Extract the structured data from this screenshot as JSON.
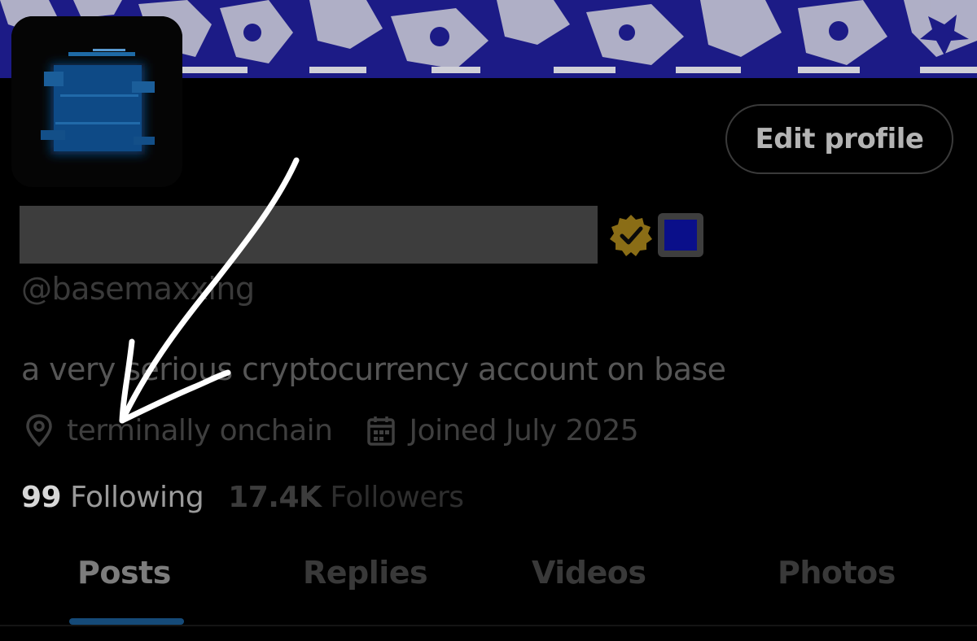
{
  "profile": {
    "handle": "@basemaxxing",
    "bio": "a very serious cryptocurrency account on base",
    "location": "terminally onchain",
    "joined": "Joined July 2025",
    "edit_profile_label": "Edit profile"
  },
  "stats": {
    "following_count": "99",
    "following_label": "Following",
    "followers_count": "17.4K",
    "followers_label": "Followers"
  },
  "tabs": [
    {
      "label": "Posts",
      "active": true
    },
    {
      "label": "Replies",
      "active": false
    },
    {
      "label": "Videos",
      "active": false
    },
    {
      "label": "Photos",
      "active": false
    }
  ],
  "icons": {
    "location": "map-pin-icon",
    "joined": "calendar-icon",
    "verified": "verified-badge-icon",
    "affiliate": "affiliate-badge-icon"
  },
  "colors": {
    "background": "#000000",
    "banner_blue": "#1a1a8a",
    "verified_gold": "#9a7a1c",
    "tab_indicator": "#154a78",
    "affiliate_blue": "#0a0f8a"
  }
}
